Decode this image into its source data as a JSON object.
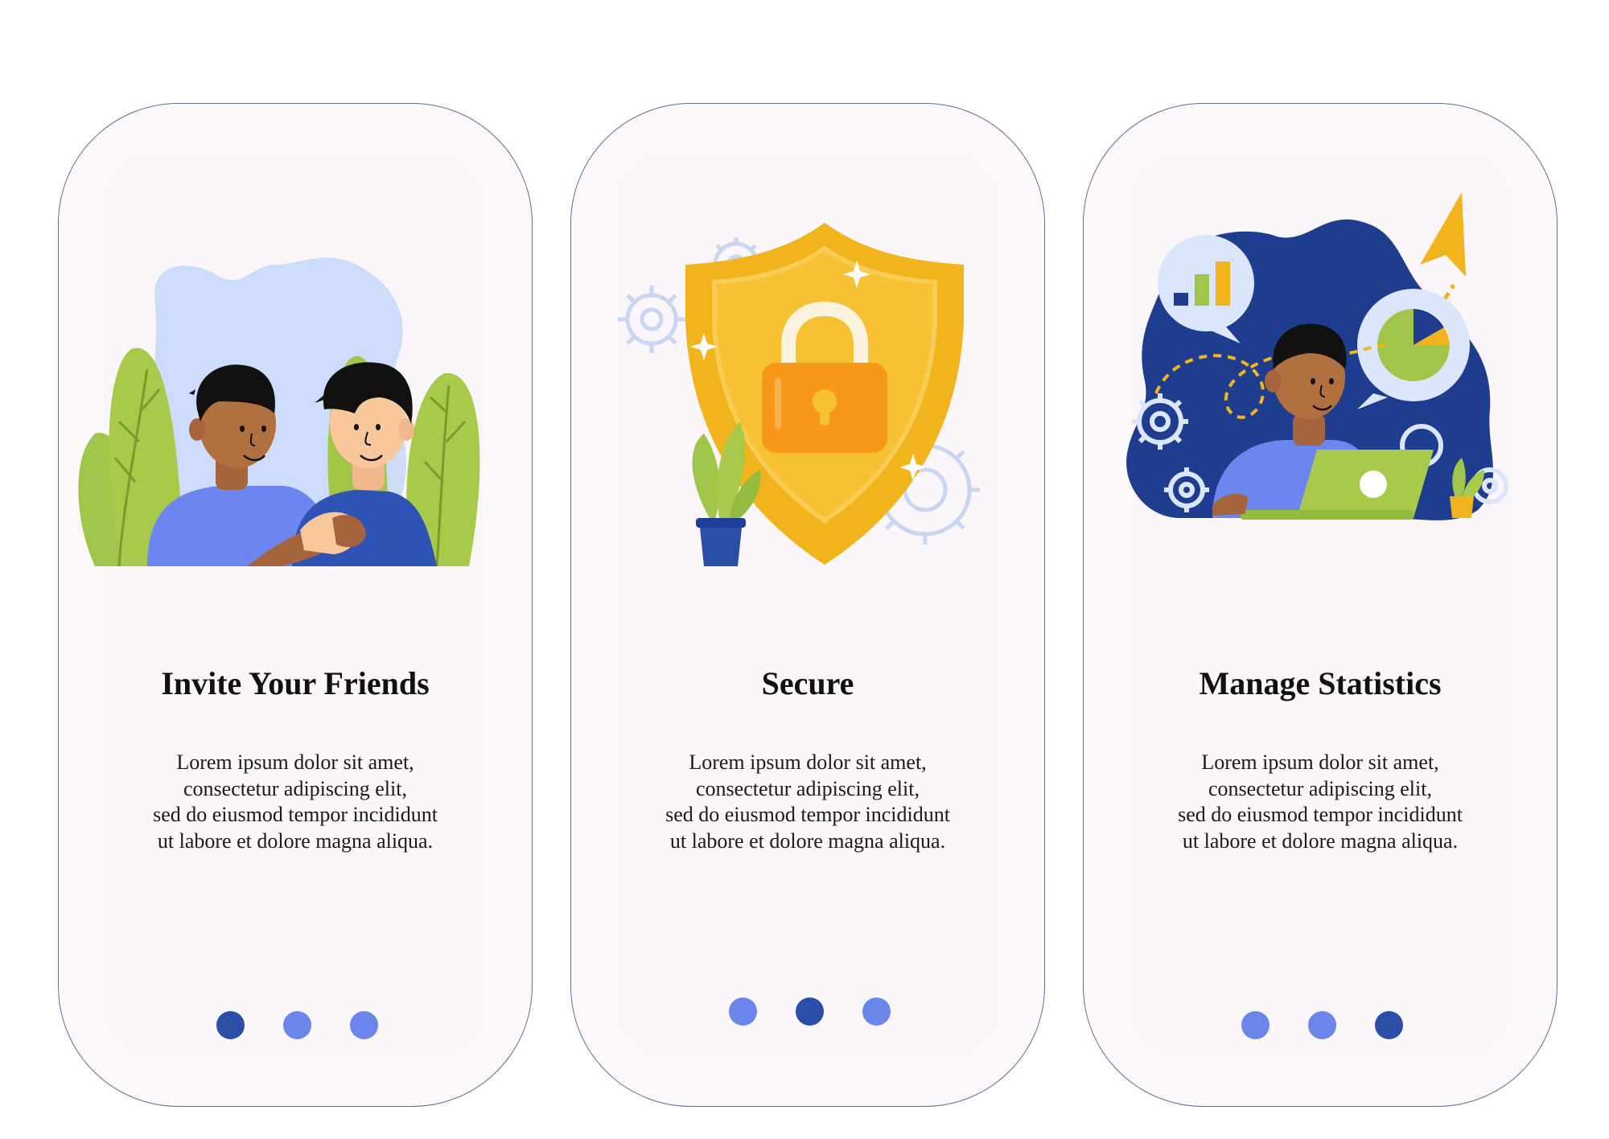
{
  "colors": {
    "dot_active": "#2b4fa6",
    "dot_inactive": "#6a86ea",
    "card_bg": "#fdf9fb",
    "card_border": "#5f6f8f"
  },
  "cards": [
    {
      "illustration": "two-friends-handshake-illustration",
      "title": "Invite Your Friends",
      "body_lines": [
        "Lorem ipsum dolor sit amet,",
        "consectetur adipiscing elit,",
        "sed do eiusmod tempor incididunt",
        "ut labore et dolore magna aliqua."
      ],
      "active_dot": 1,
      "dot_count": 3
    },
    {
      "illustration": "shield-padlock-illustration",
      "title": "Secure",
      "body_lines": [
        "Lorem ipsum dolor sit amet,",
        "consectetur adipiscing elit,",
        "sed do eiusmod tempor incididunt",
        "ut labore et dolore magna aliqua."
      ],
      "active_dot": 2,
      "dot_count": 3
    },
    {
      "illustration": "person-laptop-statistics-illustration",
      "title": "Manage Statistics",
      "body_lines": [
        "Lorem ipsum dolor sit amet,",
        "consectetur adipiscing elit,",
        "sed do eiusmod tempor incididunt",
        "ut labore et dolore magna aliqua."
      ],
      "active_dot": 3,
      "dot_count": 3
    }
  ]
}
